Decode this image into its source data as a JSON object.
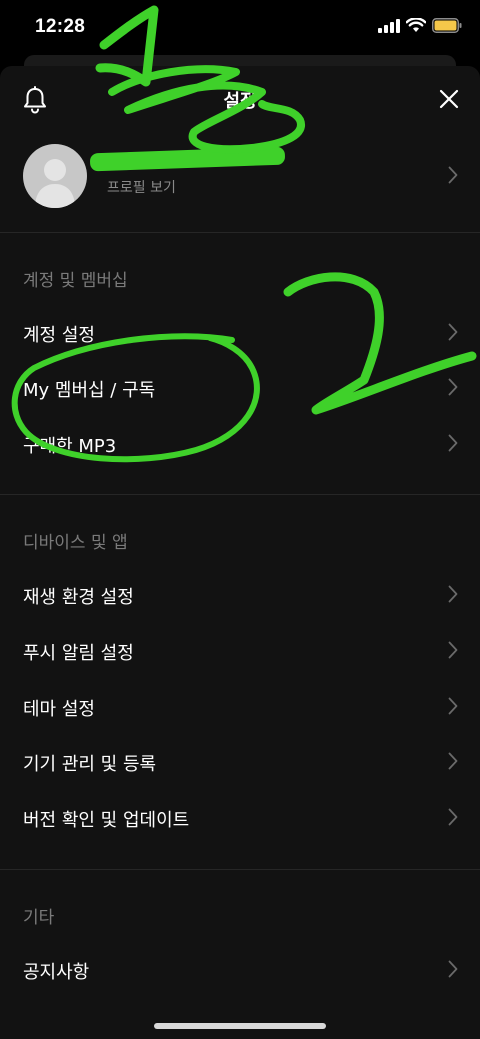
{
  "status": {
    "time": "12:28",
    "icons": [
      "signal-icon",
      "wifi-icon",
      "battery-icon"
    ],
    "battery_color": "#f5c84a"
  },
  "header": {
    "title": "설정",
    "left_icon": "bell-icon",
    "right_icon": "close-icon"
  },
  "profile": {
    "view_label": "프로필 보기"
  },
  "sections": [
    {
      "header": "계정 및 멤버십",
      "items": [
        {
          "label": "계정 설정"
        },
        {
          "label": "My 멤버십 / 구독"
        },
        {
          "label": "구매한 MP3"
        }
      ]
    },
    {
      "header": "디바이스 및 앱",
      "items": [
        {
          "label": "재생 환경 설정"
        },
        {
          "label": "푸시 알림 설정"
        },
        {
          "label": "테마 설정"
        },
        {
          "label": "기기 관리 및 등록"
        },
        {
          "label": "버전 확인 및 업데이트"
        }
      ]
    },
    {
      "header": "기타",
      "items": [
        {
          "label": "공지사항"
        }
      ]
    }
  ],
  "colors": {
    "background": "#121212",
    "annotation": "#3fd12a"
  }
}
